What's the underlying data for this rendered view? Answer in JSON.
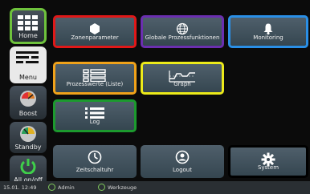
{
  "sidebar": {
    "home_label": "Home",
    "menu_label": "Menu",
    "boost_label": "Boost",
    "standby_label": "Standby",
    "allonoff_label": "All on/off"
  },
  "tiles": {
    "zonenparameter": "Zonenparameter",
    "globale": "Globale Prozessfunktionen",
    "monitoring": "Monitoring",
    "prozesswerte": "Prozesswerte (Liste)",
    "graph": "Graph",
    "log": "Log",
    "zeitschaltuhr": "Zeitschaltuhr",
    "logout": "Logout",
    "system": "System"
  },
  "status": {
    "datetime": "15.01. 12:49",
    "user": "Admin",
    "tool": "Werkzeuge"
  },
  "highlight_colors": {
    "red": "#e01818",
    "purple": "#6b2fb0",
    "blue": "#2a8fe6",
    "orange": "#f0a21a",
    "yellow": "#ecea1a",
    "green": "#1c9a2e",
    "light_green": "#6ec23c"
  }
}
